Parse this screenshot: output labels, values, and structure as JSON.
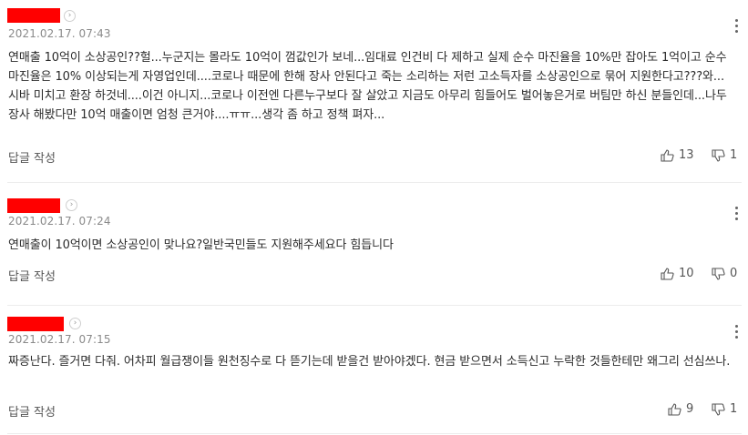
{
  "comments": [
    {
      "date": "2021.02.17. 07:43",
      "text": "연매출 10억이 소상공인??헐...누군지는 몰라도 10억이 껌값인가 보네...임대료 인건비 다 제하고 실제 순수 마진율을 10%만 잡아도 1억이고 순수 마진율은 10% 이상되는게 자영업인데....코로나 때문에 한해 장사 안된다고 죽는 소리하는 저런 고소득자를 소상공인으로 묶어 지원한다고???와...시바 미치고 환장 하것네....이건 아니지...코로나 이전엔 다른누구보다 잘 살았고 지금도 아무리 힘들어도 벌어놓은거로 버팀만 하신 분들인데...나두 장사 해봤다만 10억 매출이면 엄청 큰거야....ㅠㅠ...생각 좀 하고 정책 펴자...",
      "reply_label": "답글 작성",
      "likes": "13",
      "dislikes": "1"
    },
    {
      "date": "2021.02.17. 07:24",
      "text": "연매출이 10억이면 소상공인이 맞나요?일반국민들도 지원해주세요다 힘듭니다",
      "reply_label": "답글 작성",
      "likes": "10",
      "dislikes": "0"
    },
    {
      "date": "2021.02.17. 07:15",
      "text": "짜증난다. 즐거면 다줘. 어차피 월급쟁이들 원천징수로 다 뜯기는데 받을건 받아야겠다. 현금 받으면서 소득신고 누락한 것들한테만 왜그리 선심쓰나.",
      "reply_label": "답글 작성",
      "likes": "9",
      "dislikes": "1"
    }
  ],
  "colors": {
    "redaction": "#ff0000",
    "date": "#8a8a8a",
    "divider": "#ececec"
  },
  "icons": {
    "arrow": "chevron-right-icon",
    "more": "more-vertical-icon",
    "like": "thumbs-up-icon",
    "dislike": "thumbs-down-icon"
  }
}
